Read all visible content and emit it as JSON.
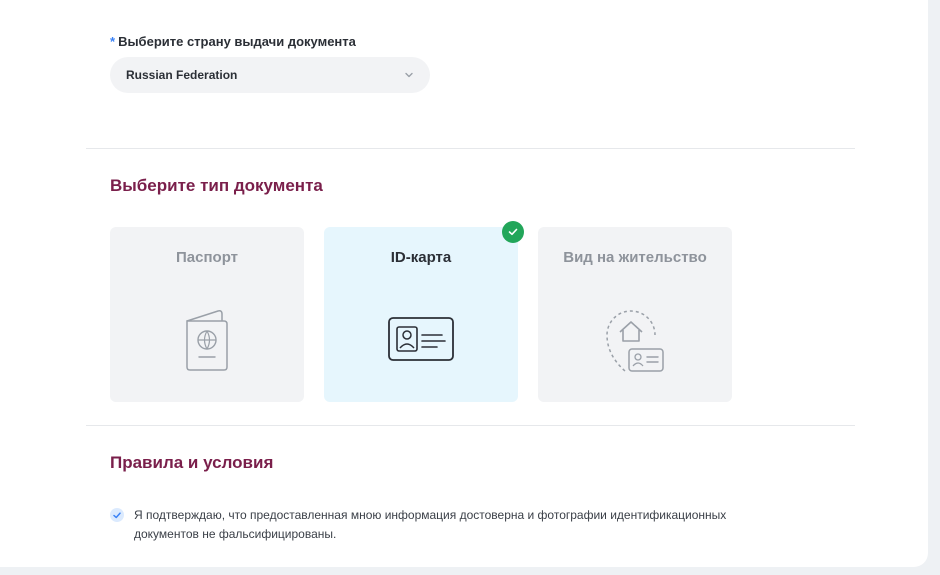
{
  "country": {
    "required_mark": "*",
    "label": "Выберите страну выдачи документа",
    "selected": "Russian Federation"
  },
  "doc_type": {
    "title": "Выберите тип документа",
    "options": [
      {
        "label": "Паспорт",
        "icon": "passport-icon",
        "selected": false
      },
      {
        "label": "ID-карта",
        "icon": "id-card-icon",
        "selected": true
      },
      {
        "label": "Вид на жительство",
        "icon": "residence-permit-icon",
        "selected": false
      }
    ]
  },
  "terms": {
    "title": "Правила и условия",
    "checked": true,
    "line1": "Я подтверждаю, что предоставленная мною информация достоверна и фотографии идентификационных",
    "line2": "документов не фальсифицированы."
  },
  "colors": {
    "accent": "#7a1f4b",
    "selected_bg": "#e6f6fd",
    "check_green": "#22a65a",
    "required_blue": "#3b82f6"
  }
}
